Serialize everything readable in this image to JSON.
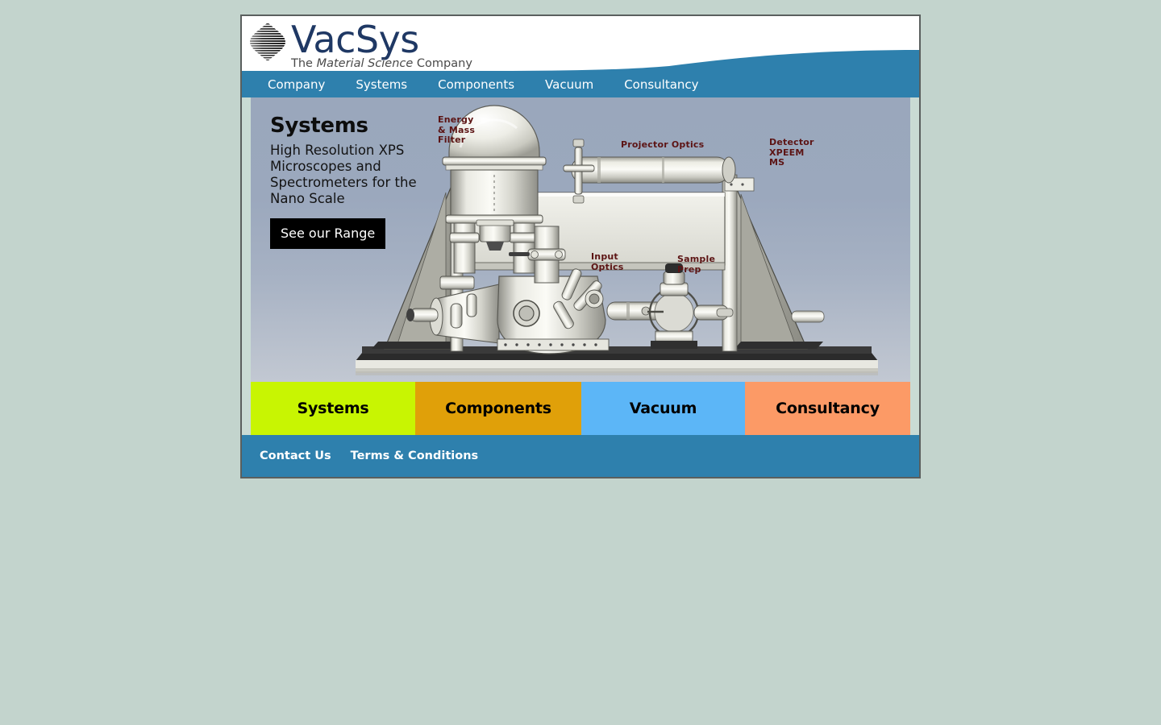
{
  "site": {
    "logo_word": "VacSys",
    "logo_tagline_pre": "The ",
    "logo_tagline_em": "Material Science",
    "logo_tagline_post": " Company",
    "logo_icon": "striped-sphere-icon"
  },
  "nav": {
    "items": [
      {
        "label": "Company"
      },
      {
        "label": "Systems"
      },
      {
        "label": "Components"
      },
      {
        "label": "Vacuum"
      },
      {
        "label": "Consultancy"
      }
    ]
  },
  "hero": {
    "title": "Systems",
    "subtitle": "High Resolution XPS Microscopes and Spectrometers for the Nano Scale",
    "cta_label": "See our Range",
    "image_alt": "xps-microscope-diagram",
    "labels": [
      {
        "text": "Energy\n& Mass\nFilter"
      },
      {
        "text": "Projector Optics"
      },
      {
        "text": "Detector\nXPEEM\nMS"
      },
      {
        "text": "Input\nOptics"
      },
      {
        "text": "Sample\nPrep"
      }
    ]
  },
  "tiles": [
    {
      "label": "Systems",
      "color": "#c8f502"
    },
    {
      "label": "Components",
      "color": "#e0a009"
    },
    {
      "label": "Vacuum",
      "color": "#5cb6f7"
    },
    {
      "label": "Consultancy",
      "color": "#fc9a66"
    }
  ],
  "footer": {
    "links": [
      {
        "label": "Contact Us"
      },
      {
        "label": "Terms & Conditions"
      }
    ]
  },
  "colors": {
    "brand_blue": "#2e80ad",
    "logo_navy": "#1f3864",
    "page_background": "#c3d4cd",
    "label_maroon": "#5c1414"
  }
}
